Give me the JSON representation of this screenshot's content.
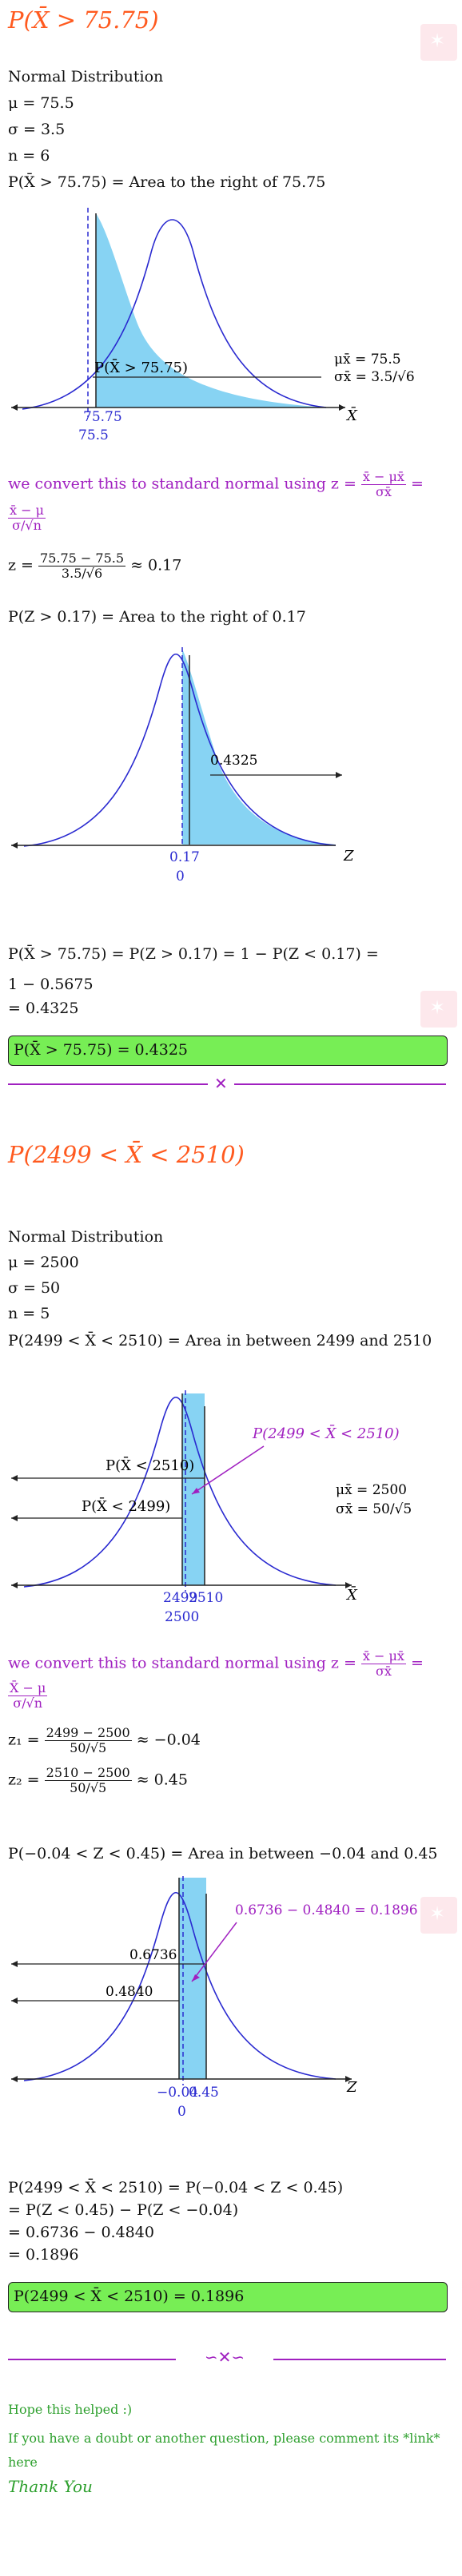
{
  "part1": {
    "title": "P(X̄ > 75.75)",
    "dist": "Normal Distribution",
    "mu": "μ = 75.5",
    "sigma": "σ = 3.5",
    "n": "n = 6",
    "area_statement": "P(X̄ > 75.75) = Area to the right of 75.75",
    "chart1": {
      "region_label": "P(X̄ > 75.75)",
      "mu_label": "μx̄ = 75.5",
      "sigma_label": "σx̄ = 3.5/√6",
      "axis_label": "X̄",
      "tick_value": "75.75",
      "mean_value": "75.5"
    },
    "convert_text": "we convert this to standard normal using z =",
    "convert_frac_num": "x̄ − μx̄",
    "convert_frac_den": "σx̄",
    "convert_eq": "=",
    "convert_frac2_num": "x̄ − μ",
    "convert_frac2_den": "σ/√n",
    "z_prefix": "z =",
    "z_num": "75.75 − 75.5",
    "z_den": "3.5/√6",
    "z_result": "≈ 0.17",
    "area_statement2": "P(Z > 0.17) = Area to the right of 0.17",
    "chart2": {
      "area_value": "0.4325",
      "axis_label": "Z",
      "tick_value": "0.17",
      "mean_value": "0"
    },
    "calc_line1": "P(X̄ > 75.75) = P(Z > 0.17) = 1 − P(Z < 0.17) =",
    "calc_line2": "1 − 0.5675",
    "calc_line3": "= 0.4325",
    "answer": "P(X̄ > 75.75) = 0.4325"
  },
  "part2": {
    "title": "P(2499 < X̄ < 2510)",
    "dist": "Normal Distribution",
    "mu": "μ = 2500",
    "sigma": "σ = 50",
    "n": "n = 5",
    "area_statement": "P(2499 < X̄ < 2510) = Area in between 2499 and 2510",
    "chart3": {
      "region_label": "P(2499 < X̄ < 2510)",
      "left_label1": "P(X̄ < 2510)",
      "left_label2": "P(X̄ < 2499)",
      "mu_label": "μx̄ = 2500",
      "sigma_label": "σx̄ = 50/√5",
      "axis_label": "X̄",
      "tick_low": "2499",
      "tick_high": "2510",
      "mean_value": "2500"
    },
    "convert_text": "we convert this to standard normal using z =",
    "convert_frac_num": "x̄ − μx̄",
    "convert_frac_den": "σx̄",
    "convert_eq": "=",
    "convert_frac2_num": "X̄ − μ",
    "convert_frac2_den": "σ/√n",
    "z1_prefix": "z₁ =",
    "z1_num": "2499 − 2500",
    "z1_den": "50/√5",
    "z1_result": "≈ −0.04",
    "z2_prefix": "z₂ =",
    "z2_num": "2510 − 2500",
    "z2_den": "50/√5",
    "z2_result": "≈ 0.45",
    "area_statement2": "P(−0.04 < Z < 0.45) = Area in between −0.04 and 0.45",
    "chart4": {
      "region_label": "0.6736 − 0.4840 = 0.1896",
      "left_value1": "0.6736",
      "left_value2": "0.4840",
      "axis_label": "Z",
      "tick_low": "−0.04",
      "tick_high": "0.45",
      "mean_value": "0"
    },
    "calc_line1": "P(2499 < X̄ < 2510) = P(−0.04 < Z < 0.45)",
    "calc_line2": "= P(Z < 0.45) − P(Z < −0.04)",
    "calc_line3": "= 0.6736 − 0.4840",
    "calc_line4": "= 0.1896",
    "answer": "P(2499 < X̄ < 2510) = 0.1896"
  },
  "footer": {
    "hope": "Hope this helped  :)",
    "comment": "If you have a doubt or another question, please comment its *link*",
    "here": "here",
    "thanks": "Thank You"
  },
  "colors": {
    "title": "#ff5a1f",
    "curve": "#2a2ad0",
    "shade": "#87d3f3",
    "purple": "#a020c0",
    "answer_bg": "#77ee55",
    "green_text": "#2ea02e"
  }
}
